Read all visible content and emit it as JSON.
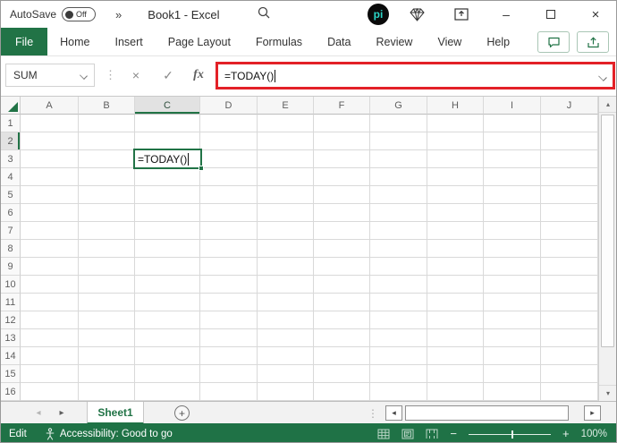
{
  "window": {
    "title": "Book1 - Excel"
  },
  "titlebar": {
    "autosave_label": "AutoSave",
    "autosave_state": "Off"
  },
  "icons": {
    "quick_access_chevrons": "»",
    "separator_dots": "⋮",
    "cancel": "×",
    "enter": "✓",
    "insert_function": "fx",
    "scroll_up": "▴",
    "scroll_down": "▾",
    "scroll_left": "◂",
    "scroll_right": "▸",
    "prev_sheet": "◂",
    "next_sheet": "▸",
    "add_sheet": "+",
    "zoom_out": "−",
    "zoom_in": "+",
    "minimize": "–",
    "close": "×",
    "pi_logo_text": "pi"
  },
  "ribbon": {
    "tabs": [
      "File",
      "Home",
      "Insert",
      "Page Layout",
      "Formulas",
      "Data",
      "Review",
      "View",
      "Help"
    ],
    "active_tab": "File"
  },
  "formula_bar": {
    "name_box": "SUM",
    "formula": "=TODAY()"
  },
  "grid": {
    "columns": [
      "A",
      "B",
      "C",
      "D",
      "E",
      "F",
      "G",
      "H",
      "I",
      "J"
    ],
    "row_numbers": [
      "1",
      "2",
      "3",
      "4",
      "5",
      "6",
      "7",
      "8",
      "9",
      "10",
      "11",
      "12",
      "13",
      "14",
      "15",
      "16"
    ],
    "selected_column": "C",
    "selected_row": "2",
    "active_cell": {
      "ref": "C2",
      "value": "=TODAY()"
    }
  },
  "sheet_bar": {
    "active_sheet": "Sheet1"
  },
  "status_bar": {
    "mode": "Edit",
    "accessibility_text": "Accessibility: Good to go",
    "zoom_level": "100%"
  },
  "colors": {
    "excel_green": "#217346",
    "status_bar_green": "#1F7246",
    "annotation_red": "#E32127",
    "pi_logo_cyan": "#2BD6C8"
  }
}
